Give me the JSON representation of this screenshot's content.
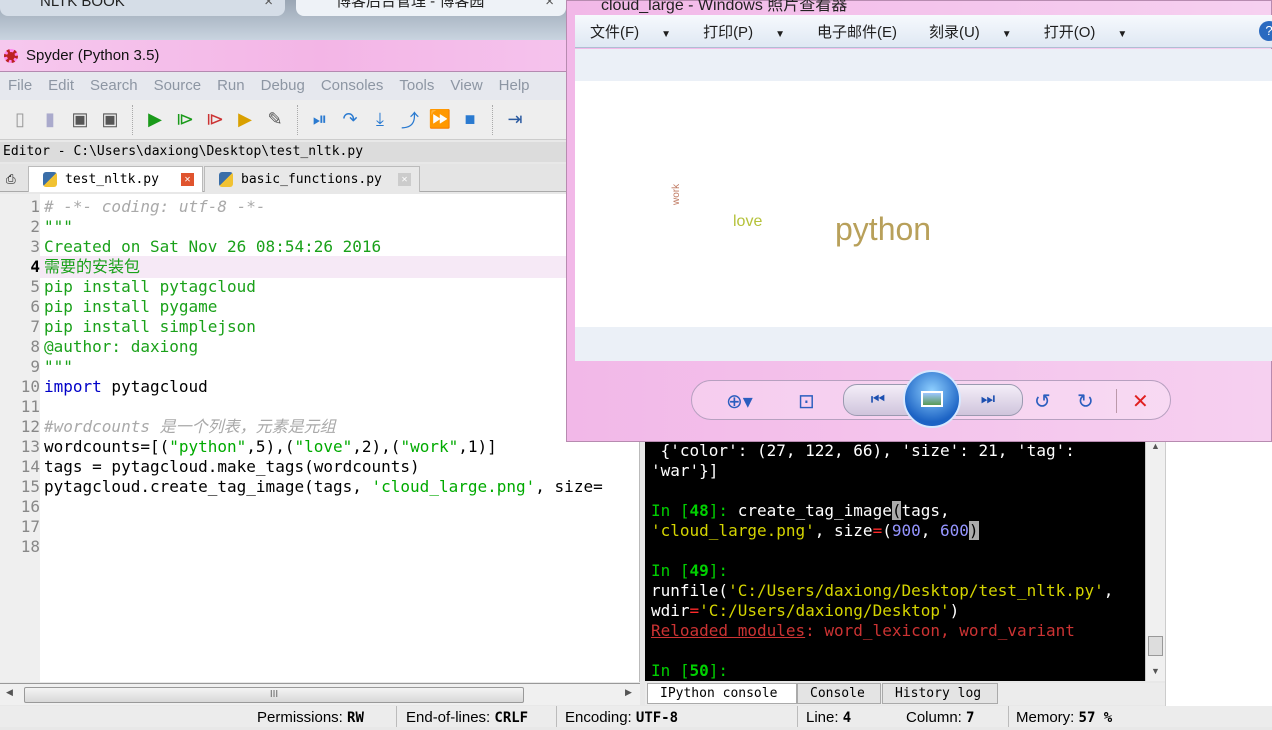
{
  "browser": {
    "tabs": [
      {
        "label": "NLTK BOOK"
      },
      {
        "label": "博客后台管理 - 博客园"
      }
    ],
    "close": "×"
  },
  "spyder": {
    "title": "Spyder (Python 3.5)",
    "menu": [
      "File",
      "Edit",
      "Search",
      "Source",
      "Run",
      "Debug",
      "Consoles",
      "Tools",
      "View",
      "Help"
    ],
    "toolbar_icons": [
      "new-file-icon",
      "open-file-icon",
      "save-icon",
      "save-all-icon",
      "run-icon",
      "run-cell-icon",
      "run-cell-advance-icon",
      "run-selection-icon",
      "configure-run-icon",
      "debug-icon",
      "step-icon",
      "step-into-icon",
      "step-return-icon",
      "continue-icon",
      "stop-icon",
      "maximize-pane-icon"
    ],
    "editor_path": "Editor - C:\\Users\\daxiong\\Desktop\\test_nltk.py",
    "tabs": [
      {
        "label": "test_nltk.py",
        "active": true
      },
      {
        "label": "basic_functions.py",
        "active": false
      }
    ],
    "current_line": 4,
    "code": [
      {
        "n": "1",
        "t": "# -*- coding: utf-8 -*-",
        "c": "cmt"
      },
      {
        "n": "2",
        "t": "\"\"\"",
        "c": "str"
      },
      {
        "n": "3",
        "t": "Created on Sat Nov 26 08:54:26 2016",
        "c": "str"
      },
      {
        "n": "4",
        "t": "需要的安装包",
        "c": "str"
      },
      {
        "n": "5",
        "t": "pip install pytagcloud",
        "c": "str"
      },
      {
        "n": "6",
        "t": "pip install pygame",
        "c": "str"
      },
      {
        "n": "7",
        "t": "pip install simplejson",
        "c": "str"
      },
      {
        "n": "8",
        "t": "@author: daxiong",
        "c": "str"
      },
      {
        "n": "9",
        "t": "\"\"\"",
        "c": "str"
      },
      {
        "n": "10",
        "kw": "import",
        "t": " pytagcloud"
      },
      {
        "n": "11",
        "t": ""
      },
      {
        "n": "12",
        "t": "#wordcounts 是一个列表，元素是元组",
        "c": "cmt"
      },
      {
        "n": "13",
        "p1": "wordcounts=[(",
        "s1": "\"python\"",
        "p2": ",5),(",
        "s2": "\"love\"",
        "p3": ",2),(",
        "s3": "\"work\"",
        "p4": ",1)]"
      },
      {
        "n": "14",
        "t": "tags = pytagcloud.make_tags(wordcounts)"
      },
      {
        "n": "15",
        "p1": "pytagcloud.create_tag_image(tags, ",
        "s1": "'cloud_large.png'",
        "p2": ", size="
      },
      {
        "n": "16",
        "t": ""
      },
      {
        "n": "17",
        "t": ""
      },
      {
        "n": "18",
        "t": ""
      }
    ],
    "scroll_grip": "III",
    "status": {
      "permissions_label": "Permissions:",
      "permissions": "RW",
      "eol_label": "End-of-lines:",
      "eol": "CRLF",
      "encoding_label": "Encoding:",
      "encoding": "UTF-8",
      "line_label": "Line:",
      "line": "4",
      "column_label": "Column:",
      "column": "7",
      "memory_label": "Memory:",
      "memory": "57 %"
    }
  },
  "viewer": {
    "title": "cloud_large - Windows 照片查看器",
    "menu": [
      {
        "label": "文件(F)",
        "dropdown": true
      },
      {
        "label": "打印(P)",
        "dropdown": true
      },
      {
        "label": "电子邮件(E)",
        "dropdown": false
      },
      {
        "label": "刻录(U)",
        "dropdown": true
      },
      {
        "label": "打开(O)",
        "dropdown": true
      }
    ],
    "help": "?",
    "cloud": [
      {
        "word": "python",
        "color": "#b8a05a"
      },
      {
        "word": "love",
        "color": "#b5c23a"
      },
      {
        "word": "work",
        "color": "#c07a62"
      }
    ],
    "controls": [
      "zoom-icon",
      "fit-window-icon",
      "previous-icon",
      "slideshow-icon",
      "next-icon",
      "rotate-ccw-icon",
      "rotate-cw-icon",
      "delete-icon"
    ]
  },
  "console": {
    "l1": " {'color': (27, 122, 66), 'size': 21, 'tag':",
    "l2": "'war'}]",
    "in48": "In [",
    "n48": "48",
    "in48e": "]: ",
    "c48a": "create_tag_image",
    "c48b": "(",
    "c48c": "tags,",
    "l48s": "'cloud_large.png'",
    "l48b": ", size",
    "eq": "=",
    "lp": "(",
    "v900": "900",
    "comma": ", ",
    "v600": "600",
    "rp": ")",
    "in49": "In [",
    "n49": "49",
    "in49e": "]:",
    "run1": "runfile(",
    "run1s": "'C:/Users/daxiong/Desktop/test_nltk.py'",
    "run1e": ",",
    "run2": "wdir",
    "run2s": "'C:/Users/daxiong/Desktop'",
    "run2e": ")",
    "reload_label": "Reloaded modules",
    "reload_rest": ": word_lexicon, word_variant",
    "in50": "In [",
    "n50": "50",
    "in50e": "]:",
    "tabs": [
      "IPython console",
      "Console",
      "History log"
    ]
  }
}
